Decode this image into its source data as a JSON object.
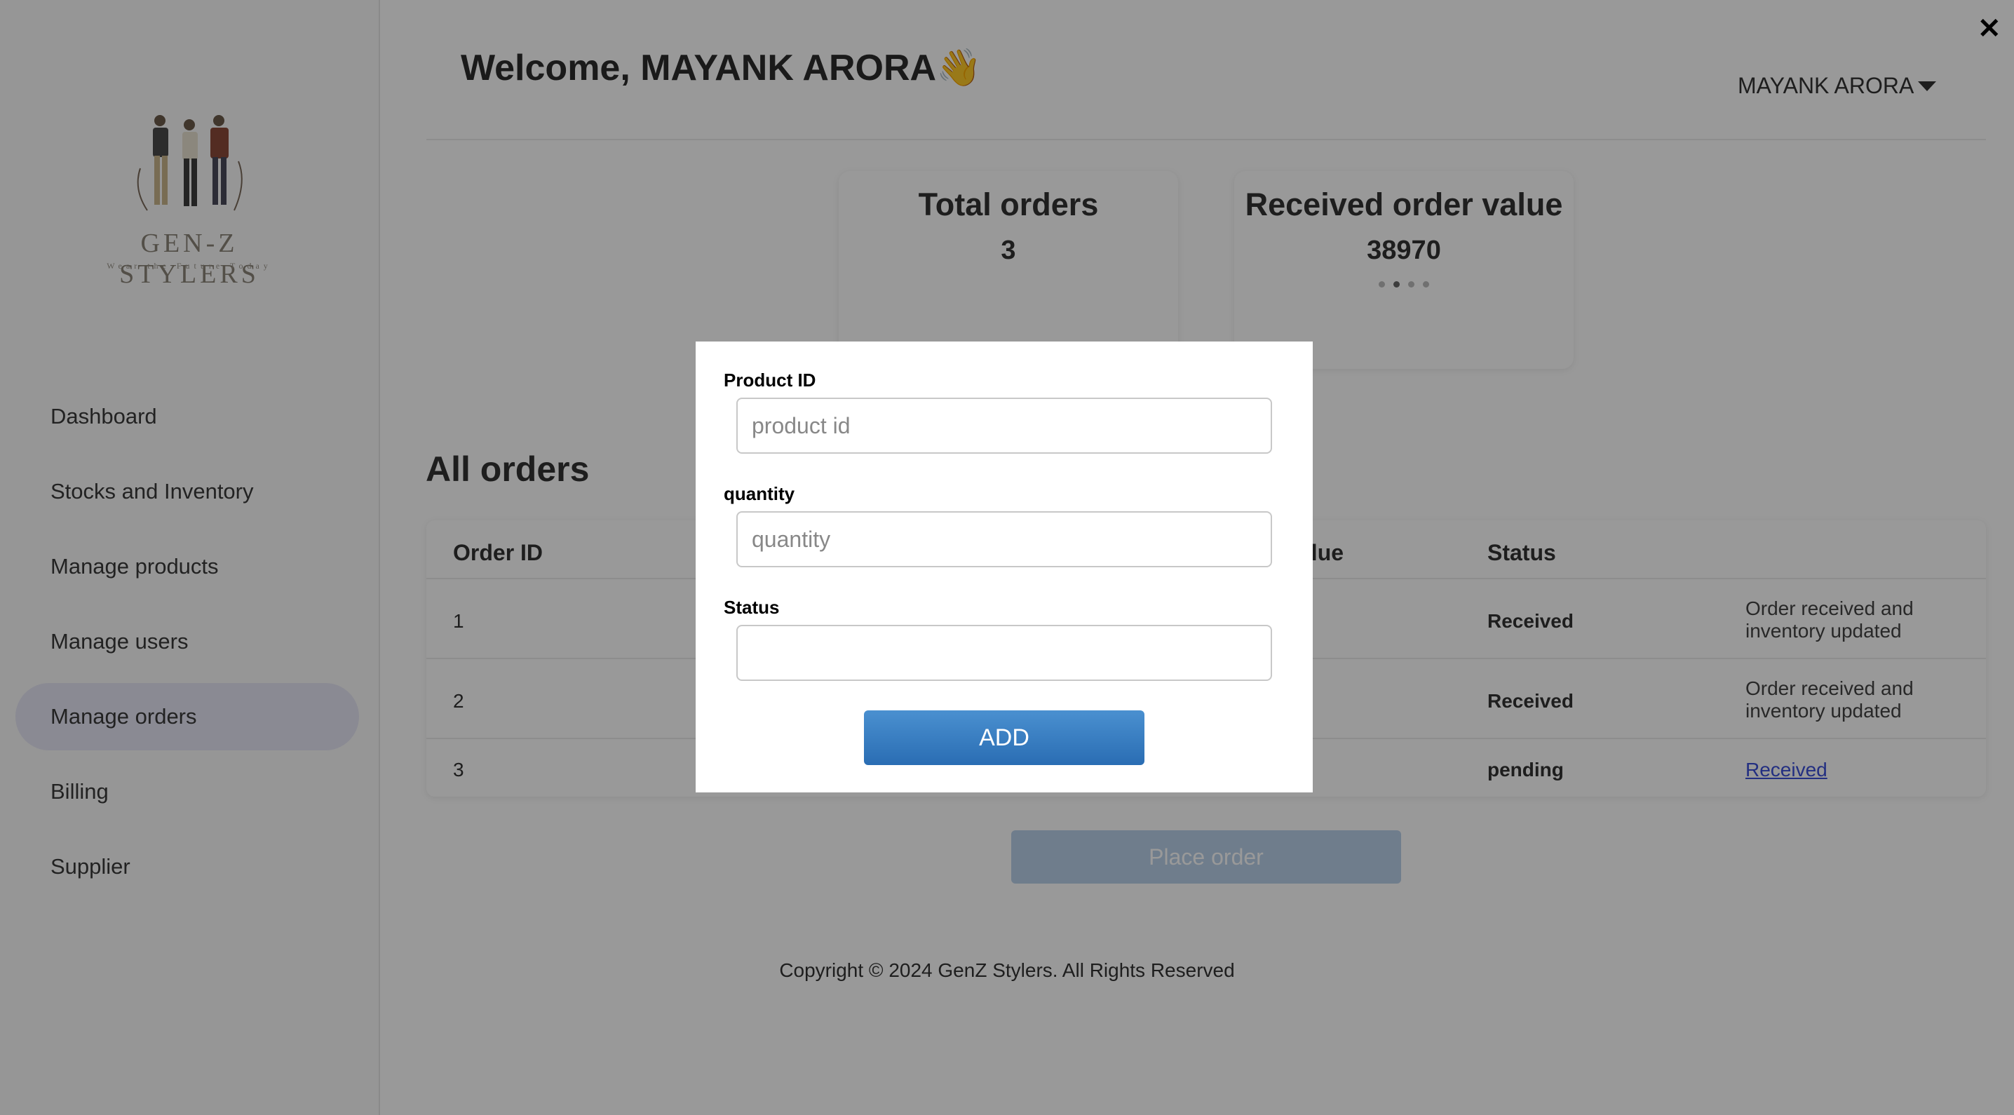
{
  "sidebar": {
    "logo": {
      "name": "GEN-Z STYLERS",
      "tagline": "Wear the Future Today"
    },
    "items": [
      {
        "label": "Dashboard"
      },
      {
        "label": "Stocks and Inventory"
      },
      {
        "label": "Manage products"
      },
      {
        "label": "Manage users"
      },
      {
        "label": "Manage orders",
        "active": true
      },
      {
        "label": "Billing"
      },
      {
        "label": "Supplier"
      }
    ]
  },
  "header": {
    "welcome": "Welcome, MAYANK ARORA👋",
    "user_name": "MAYANK ARORA"
  },
  "stats": {
    "total_orders": {
      "title": "Total orders",
      "value": "3"
    },
    "received_value": {
      "title": "Received order value",
      "value": "38970"
    }
  },
  "orders": {
    "title": "All orders",
    "columns": [
      "Order ID",
      "alue",
      "Status"
    ],
    "rows": [
      {
        "id": "1",
        "status": "Received",
        "action": "Order received and inventory updated"
      },
      {
        "id": "2",
        "status": "Received",
        "action": "Order received and inventory updated"
      },
      {
        "id": "3",
        "status": "pending",
        "action": "Received"
      }
    ],
    "place_order_label": "Place order"
  },
  "footer": {
    "copyright": "Copyright © 2024 GenZ Stylers. All Rights Reserved"
  },
  "modal": {
    "close_label": "✕",
    "product_id": {
      "label": "Product ID",
      "placeholder": "product id",
      "value": ""
    },
    "quantity": {
      "label": "quantity",
      "placeholder": "quantity",
      "value": ""
    },
    "status": {
      "label": "Status",
      "placeholder": "",
      "value": ""
    },
    "add_label": "ADD"
  },
  "colors": {
    "accent": "#2a6db3",
    "active_nav": "#e6e6f5",
    "link": "#3b4fd8"
  }
}
